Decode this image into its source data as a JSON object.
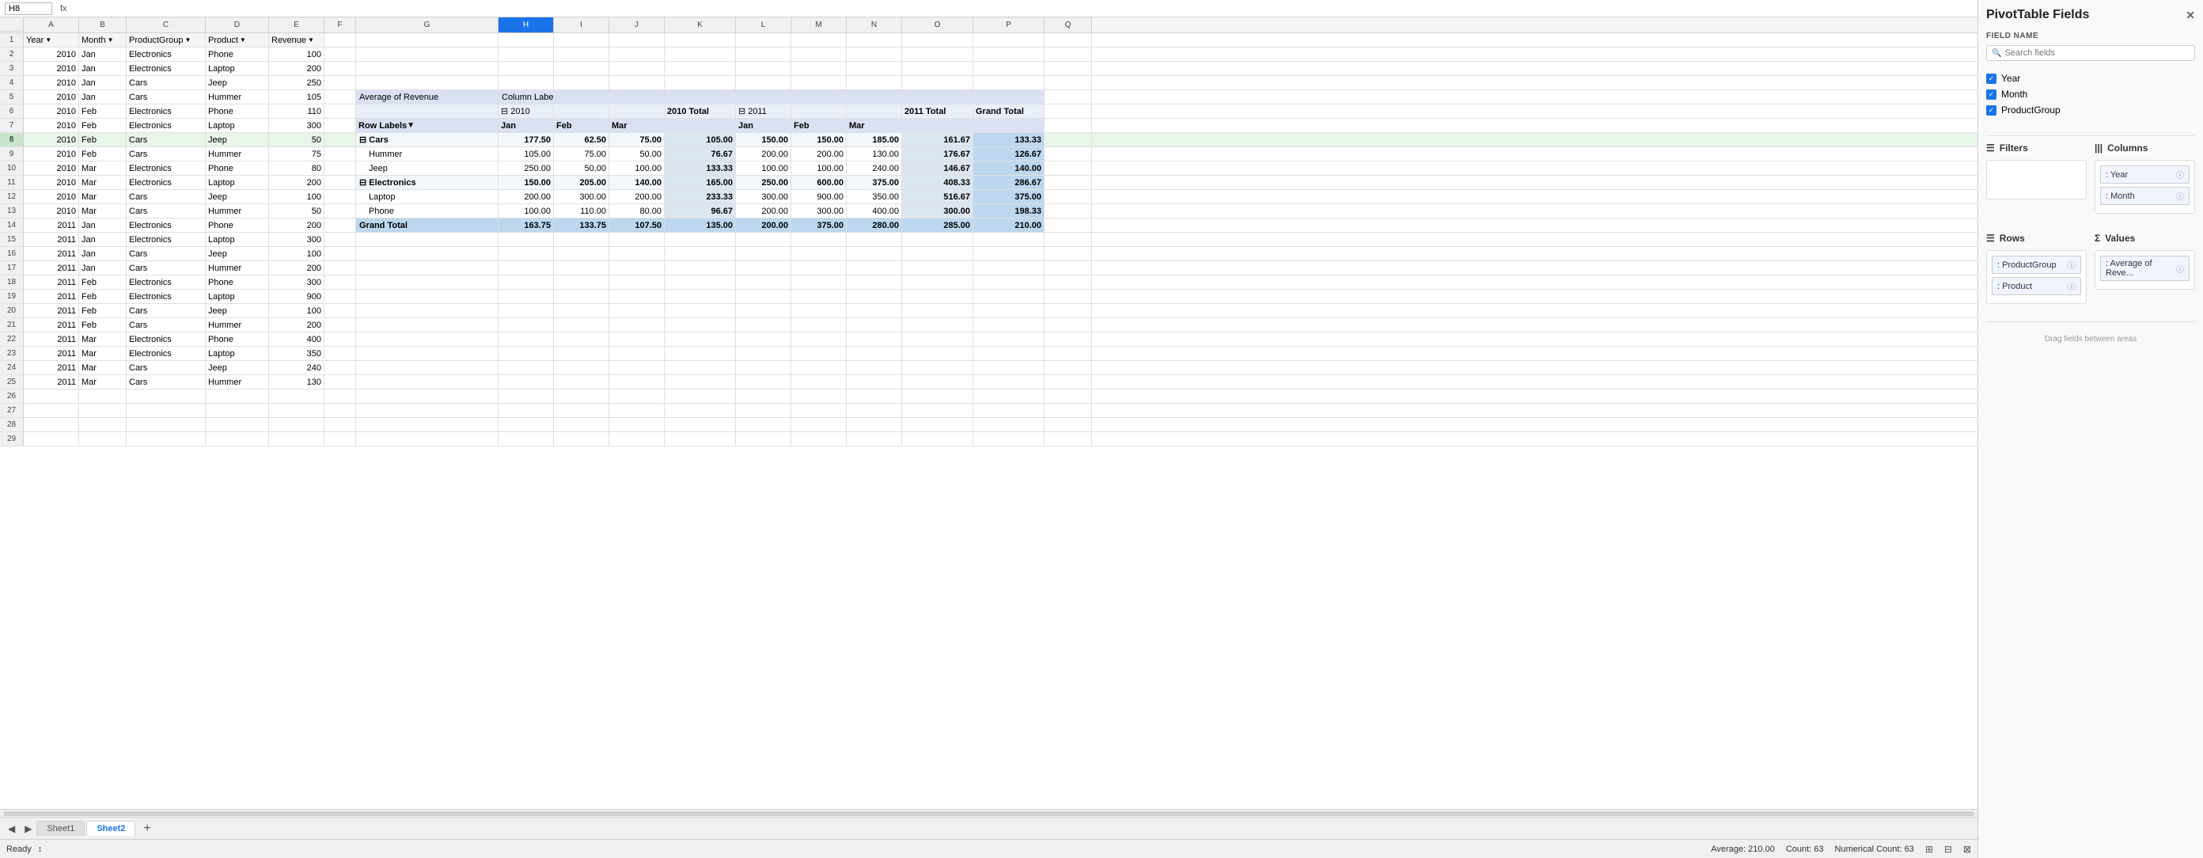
{
  "app": {
    "title": "PivotTable Fields",
    "close_btn": "✕"
  },
  "formula_bar": {
    "name_box": "H8",
    "fx": "fx"
  },
  "col_headers": [
    "",
    "A",
    "B",
    "C",
    "D",
    "E",
    "F",
    "G",
    "H",
    "I",
    "J",
    "K",
    "L",
    "M",
    "N",
    "O",
    "P",
    "Q"
  ],
  "rows": [
    {
      "num": 1,
      "cells": [
        "Year",
        "Month",
        "ProductGroup",
        "Product",
        "Revenue",
        "",
        "",
        "",
        "",
        "",
        "",
        "",
        "",
        "",
        "",
        "",
        ""
      ]
    },
    {
      "num": 2,
      "cells": [
        "2010",
        "Jan",
        "Electronics",
        "Phone",
        "100",
        "",
        "",
        "",
        "",
        "",
        "",
        "",
        "",
        "",
        "",
        "",
        ""
      ]
    },
    {
      "num": 3,
      "cells": [
        "2010",
        "Jan",
        "Electronics",
        "Laptop",
        "200",
        "",
        "",
        "",
        "",
        "",
        "",
        "",
        "",
        "",
        "",
        "",
        ""
      ]
    },
    {
      "num": 4,
      "cells": [
        "2010",
        "Jan",
        "Cars",
        "Jeep",
        "250",
        "",
        "",
        "",
        "",
        "",
        "",
        "",
        "",
        "",
        "",
        "",
        ""
      ]
    },
    {
      "num": 5,
      "cells": [
        "2010",
        "Jan",
        "Cars",
        "Hummer",
        "105",
        "",
        "",
        "",
        "Average of Revenue",
        "Column Labels",
        "",
        "",
        "",
        "",
        "",
        "",
        ""
      ]
    },
    {
      "num": 6,
      "cells": [
        "2010",
        "Feb",
        "Electronics",
        "Phone",
        "110",
        "",
        "",
        "",
        "⊟ 2010",
        "",
        "",
        "2010 Total",
        "⊟ 2011",
        "",
        "",
        "2011 Total",
        "Grand Total"
      ]
    },
    {
      "num": 7,
      "cells": [
        "2010",
        "Feb",
        "Electronics",
        "Laptop",
        "300",
        "",
        "Row Labels",
        "",
        "Jan",
        "Feb",
        "Mar",
        "",
        "Jan",
        "Feb",
        "Mar",
        "",
        ""
      ]
    },
    {
      "num": 8,
      "cells": [
        "2010",
        "Feb",
        "Cars",
        "Jeep",
        "50",
        "",
        "⊟ Cars",
        "",
        "177.50",
        "62.50",
        "75.00",
        "105.00",
        "150.00",
        "150.00",
        "185.00",
        "161.67",
        "133.33"
      ]
    },
    {
      "num": 9,
      "cells": [
        "2010",
        "Feb",
        "Cars",
        "Hummer",
        "75",
        "",
        "",
        "Hummer",
        "105.00",
        "75.00",
        "50.00",
        "76.67",
        "200.00",
        "200.00",
        "130.00",
        "176.67",
        "126.67"
      ]
    },
    {
      "num": 10,
      "cells": [
        "2010",
        "Mar",
        "Electronics",
        "Phone",
        "80",
        "",
        "",
        "Jeep",
        "250.00",
        "50.00",
        "100.00",
        "133.33",
        "100.00",
        "100.00",
        "240.00",
        "146.67",
        "140.00"
      ]
    },
    {
      "num": 11,
      "cells": [
        "2010",
        "Mar",
        "Electronics",
        "Laptop",
        "200",
        "",
        "⊟ Electronics",
        "",
        "150.00",
        "205.00",
        "140.00",
        "165.00",
        "250.00",
        "600.00",
        "375.00",
        "408.33",
        "286.67"
      ]
    },
    {
      "num": 12,
      "cells": [
        "2010",
        "Mar",
        "Cars",
        "Jeep",
        "100",
        "",
        "",
        "Laptop",
        "200.00",
        "300.00",
        "200.00",
        "233.33",
        "300.00",
        "900.00",
        "350.00",
        "516.67",
        "375.00"
      ]
    },
    {
      "num": 13,
      "cells": [
        "2010",
        "Mar",
        "Cars",
        "Hummer",
        "50",
        "",
        "",
        "Phone",
        "100.00",
        "110.00",
        "80.00",
        "96.67",
        "200.00",
        "300.00",
        "400.00",
        "300.00",
        "198.33"
      ]
    },
    {
      "num": 14,
      "cells": [
        "2011",
        "Jan",
        "Electronics",
        "Phone",
        "200",
        "",
        "Grand Total",
        "",
        "163.75",
        "133.75",
        "107.50",
        "135.00",
        "200.00",
        "375.00",
        "280.00",
        "285.00",
        "210.00"
      ]
    },
    {
      "num": 15,
      "cells": [
        "2011",
        "Jan",
        "Electronics",
        "Laptop",
        "300",
        "",
        "",
        "",
        "",
        "",
        "",
        "",
        "",
        "",
        "",
        "",
        ""
      ]
    },
    {
      "num": 16,
      "cells": [
        "2011",
        "Jan",
        "Cars",
        "Jeep",
        "100",
        "",
        "",
        "",
        "",
        "",
        "",
        "",
        "",
        "",
        "",
        "",
        ""
      ]
    },
    {
      "num": 17,
      "cells": [
        "2011",
        "Jan",
        "Cars",
        "Hummer",
        "200",
        "",
        "",
        "",
        "",
        "",
        "",
        "",
        "",
        "",
        "",
        "",
        ""
      ]
    },
    {
      "num": 18,
      "cells": [
        "2011",
        "Feb",
        "Electronics",
        "Phone",
        "300",
        "",
        "",
        "",
        "",
        "",
        "",
        "",
        "",
        "",
        "",
        "",
        ""
      ]
    },
    {
      "num": 19,
      "cells": [
        "2011",
        "Feb",
        "Electronics",
        "Laptop",
        "900",
        "",
        "",
        "",
        "",
        "",
        "",
        "",
        "",
        "",
        "",
        "",
        ""
      ]
    },
    {
      "num": 20,
      "cells": [
        "2011",
        "Feb",
        "Cars",
        "Jeep",
        "100",
        "",
        "",
        "",
        "",
        "",
        "",
        "",
        "",
        "",
        "",
        "",
        ""
      ]
    },
    {
      "num": 21,
      "cells": [
        "2011",
        "Feb",
        "Cars",
        "Hummer",
        "200",
        "",
        "",
        "",
        "",
        "",
        "",
        "",
        "",
        "",
        "",
        "",
        ""
      ]
    },
    {
      "num": 22,
      "cells": [
        "2011",
        "Mar",
        "Electronics",
        "Phone",
        "400",
        "",
        "",
        "",
        "",
        "",
        "",
        "",
        "",
        "",
        "",
        "",
        ""
      ]
    },
    {
      "num": 23,
      "cells": [
        "2011",
        "Mar",
        "Electronics",
        "Laptop",
        "350",
        "",
        "",
        "",
        "",
        "",
        "",
        "",
        "",
        "",
        "",
        "",
        ""
      ]
    },
    {
      "num": 24,
      "cells": [
        "2011",
        "Mar",
        "Cars",
        "Jeep",
        "240",
        "",
        "",
        "",
        "",
        "",
        "",
        "",
        "",
        "",
        "",
        "",
        ""
      ]
    },
    {
      "num": 25,
      "cells": [
        "2011",
        "Mar",
        "Cars",
        "Hummer",
        "130",
        "",
        "",
        "",
        "",
        "",
        "",
        "",
        "",
        "",
        "",
        "",
        ""
      ]
    },
    {
      "num": 26,
      "cells": [
        "",
        "",
        "",
        "",
        "",
        "",
        "",
        "",
        "",
        "",
        "",
        "",
        "",
        "",
        "",
        "",
        ""
      ]
    },
    {
      "num": 27,
      "cells": [
        "",
        "",
        "",
        "",
        "",
        "",
        "",
        "",
        "",
        "",
        "",
        "",
        "",
        "",
        "",
        "",
        ""
      ]
    },
    {
      "num": 28,
      "cells": [
        "",
        "",
        "",
        "",
        "",
        "",
        "",
        "",
        "",
        "",
        "",
        "",
        "",
        "",
        "",
        "",
        ""
      ]
    },
    {
      "num": 29,
      "cells": [
        "",
        "",
        "",
        "",
        "",
        "",
        "",
        "",
        "",
        "",
        "",
        "",
        "",
        "",
        "",
        "",
        ""
      ]
    }
  ],
  "sheet_tabs": [
    "Sheet1",
    "Sheet2"
  ],
  "active_tab": "Sheet2",
  "status": {
    "ready": "Ready",
    "mode_icon": "↕",
    "average": "Average: 210.00",
    "count": "Count: 63",
    "numerical_count": "Numerical Count: 63"
  },
  "pivot_panel": {
    "title": "PivotTable Fields",
    "field_name_label": "FIELD NAME",
    "search_placeholder": "Search fields",
    "fields": [
      {
        "name": "Year",
        "checked": true
      },
      {
        "name": "Month",
        "checked": true
      },
      {
        "name": "ProductGroup",
        "checked": true
      }
    ],
    "filters_label": "Filters",
    "columns_label": "Columns",
    "rows_label": "Rows",
    "values_label": "Values",
    "columns_items": [
      "Year",
      "Month"
    ],
    "rows_items": [
      "ProductGroup",
      "Product"
    ],
    "values_items": [
      "Average of Reve..."
    ],
    "drag_hint": "Drag fields between areas"
  }
}
